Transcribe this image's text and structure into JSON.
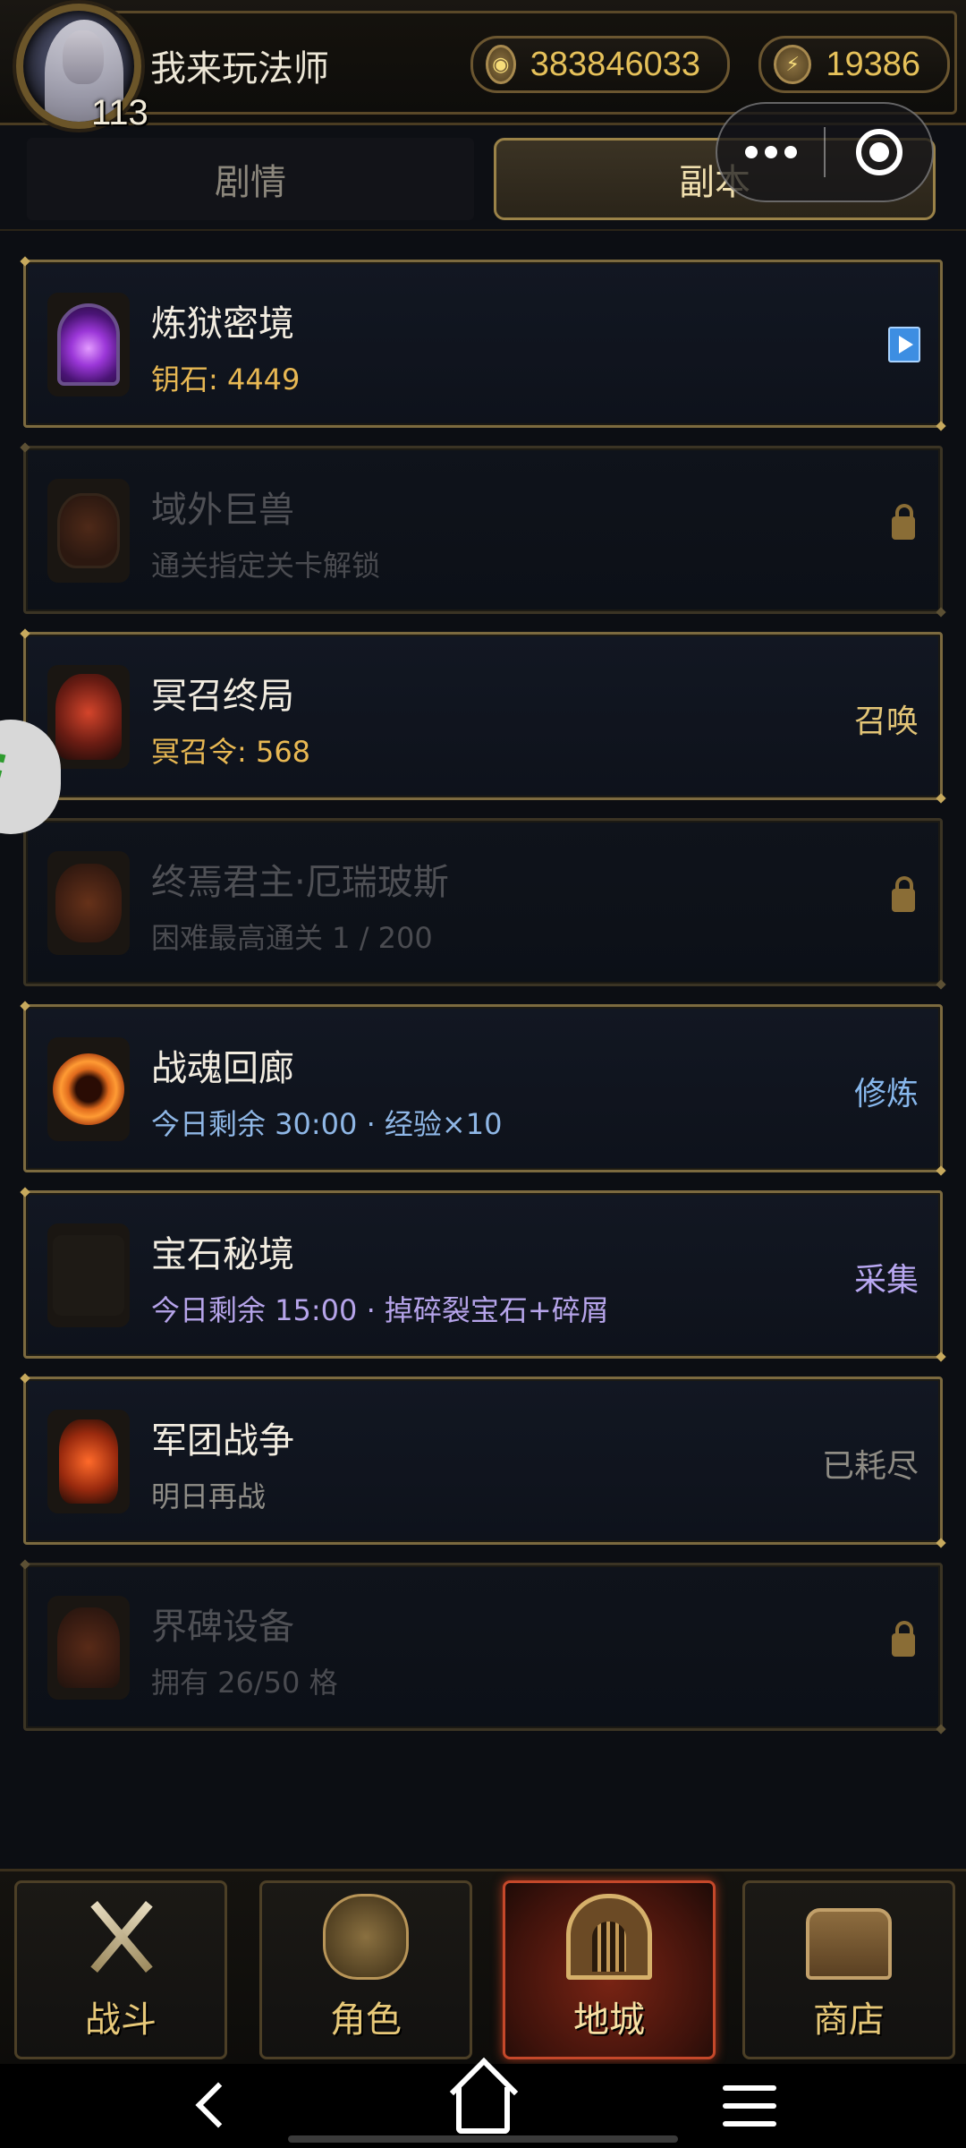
{
  "player": {
    "name": "我来玩法师",
    "level": "113"
  },
  "currencies": {
    "gold": "383846033",
    "energy": "19386"
  },
  "tabs": {
    "story": "剧情",
    "dungeon": "副本"
  },
  "dungeons": [
    {
      "title": "炼狱密境",
      "subtitle": "钥石: 4449",
      "action": "",
      "state": "play"
    },
    {
      "title": "域外巨兽",
      "subtitle": "通关指定关卡解锁",
      "action": "",
      "state": "locked"
    },
    {
      "title": "冥召终局",
      "subtitle": "冥召令: 568",
      "action": "召唤",
      "state": "open"
    },
    {
      "title": "终焉君主·厄瑞玻斯",
      "subtitle": "困难最高通关 1 / 200",
      "action": "",
      "state": "locked"
    },
    {
      "title": "战魂回廊",
      "subtitle": "今日剩余 30:00 · 经验×10",
      "action": "修炼",
      "state": "open"
    },
    {
      "title": "宝石秘境",
      "subtitle": "今日剩余 15:00 · 掉碎裂宝石+碎屑",
      "action": "采集",
      "state": "open"
    },
    {
      "title": "军团战争",
      "subtitle": "明日再战",
      "action": "已耗尽",
      "state": "exhausted"
    },
    {
      "title": "界碑设备",
      "subtitle": "拥有 26/50 格",
      "action": "",
      "state": "locked"
    }
  ],
  "bottom_nav": {
    "battle": "战斗",
    "character": "角色",
    "dungeon": "地城",
    "shop": "商店"
  },
  "colors": {
    "gold_text": "#e8b853",
    "active_nav": "#c5482a",
    "frame": "#7c6a3f"
  }
}
